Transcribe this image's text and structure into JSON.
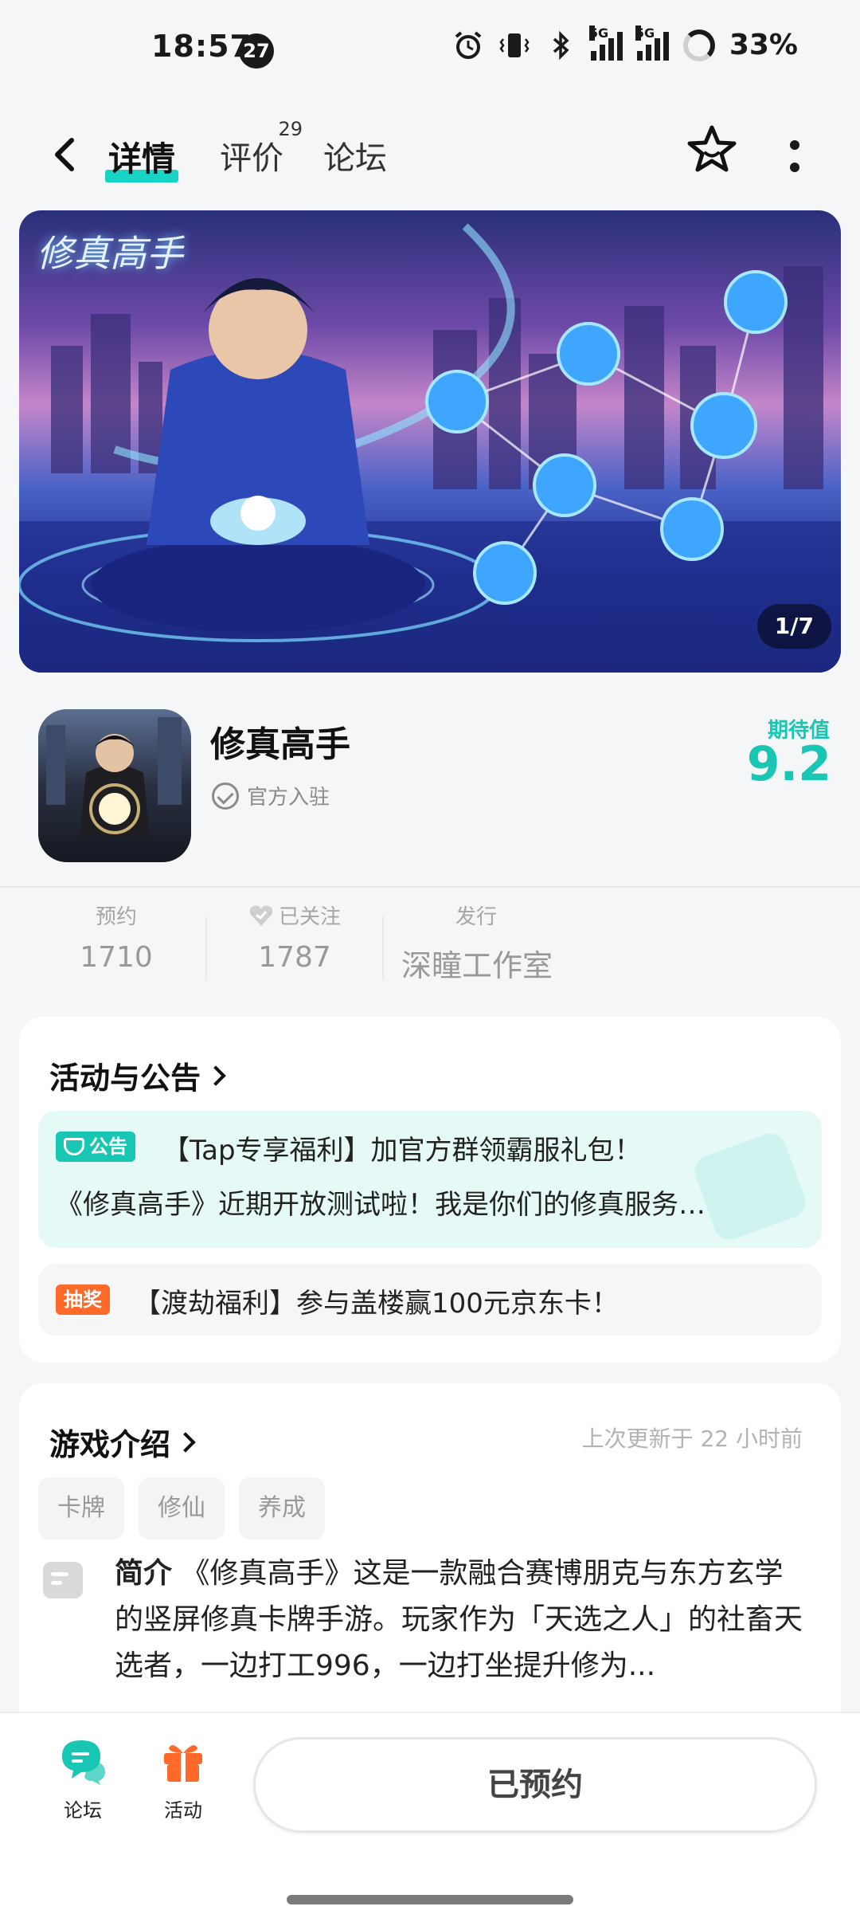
{
  "status_bar": {
    "time": "18:57",
    "notification_count": "27",
    "network_label": "5G",
    "battery_percent": "33%"
  },
  "nav": {
    "tabs": [
      {
        "label": "详情",
        "active": true
      },
      {
        "label": "评价",
        "badge": "29"
      },
      {
        "label": "论坛"
      }
    ]
  },
  "banner": {
    "logo_text": "修真高手",
    "counter": "1/7"
  },
  "app": {
    "name": "修真高手",
    "official_label": "官方入驻",
    "expectation_label": "期待值",
    "expectation_value": "9.2"
  },
  "stats": {
    "reserve_label": "预约",
    "reserve_value": "1710",
    "follow_label": "已关注",
    "follow_value": "1787",
    "publisher_label": "发行",
    "publisher_value": "深瞳工作室"
  },
  "activity": {
    "title": "活动与公告",
    "announcement": {
      "tag": "公告",
      "title": "【Tap专享福利】加官方群领霸服礼包！",
      "subtitle": "《修真高手》近期开放测试啦！我是你们的修真服务…"
    },
    "lottery": {
      "tag": "抽奖",
      "text": "【渡劫福利】参与盖楼赢100元京东卡！"
    }
  },
  "intro": {
    "title": "游戏介绍",
    "update_time": "上次更新于 22 小时前",
    "tags": [
      "卡牌",
      "修仙",
      "养成"
    ],
    "summary_label": "简介",
    "summary_text": "《修真高手》这是一款融合赛博朋克与东方玄学的竖屏修真卡牌手游。玩家作为「天选之人」的社畜天选者，一边打工996，一边打坐提升修为..."
  },
  "bottom_bar": {
    "forum_label": "论坛",
    "activity_label": "活动",
    "reserved_label": "已预约"
  },
  "colors": {
    "accent": "#19c6b4",
    "lottery": "#ff6a2a"
  }
}
